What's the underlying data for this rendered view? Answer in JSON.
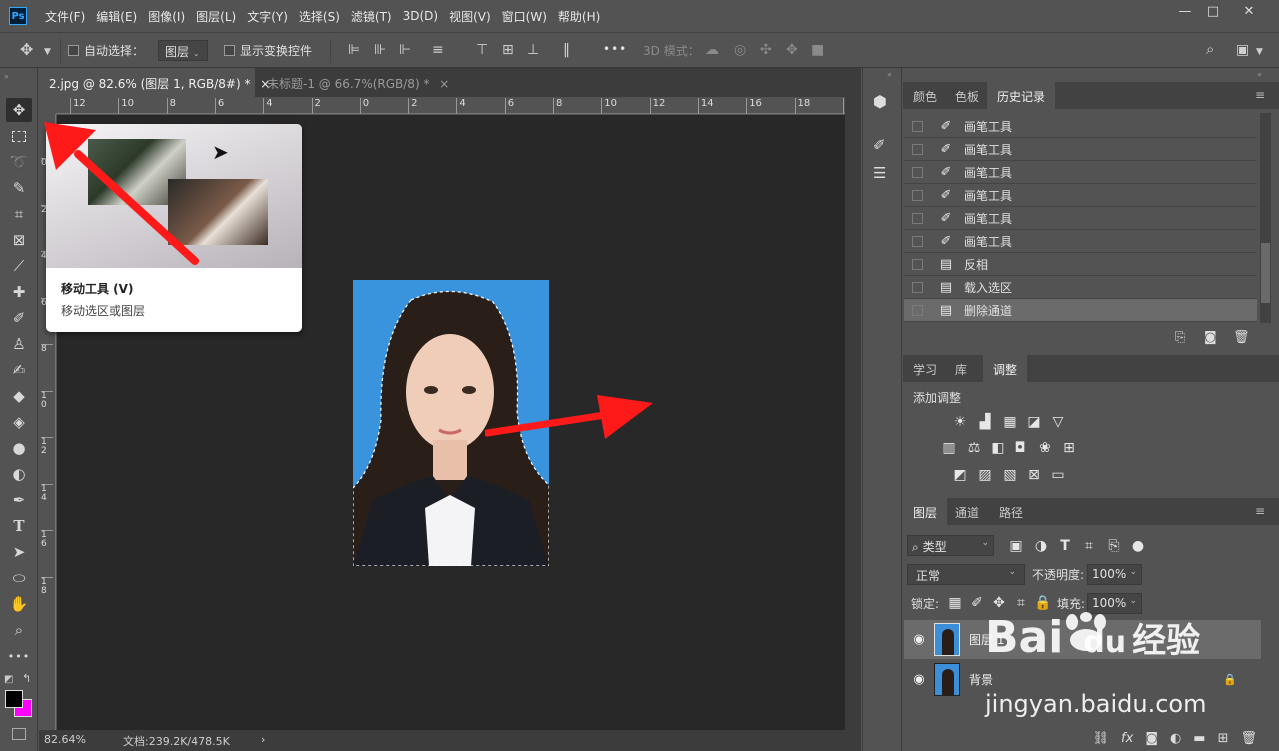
{
  "menu": {
    "logo": "Ps",
    "items": [
      "文件(F)",
      "编辑(E)",
      "图像(I)",
      "图层(L)",
      "文字(Y)",
      "选择(S)",
      "滤镜(T)",
      "3D(D)",
      "视图(V)",
      "窗口(W)",
      "帮助(H)"
    ],
    "minimize": "—",
    "restore": "□",
    "close": "✕"
  },
  "options": {
    "auto_select_label": "自动选择：",
    "auto_select_value": "图层",
    "show_transform_label": "显示变换控件",
    "more": "•••",
    "mode3d_label": "3D 模式："
  },
  "tabs": [
    {
      "label": "2.jpg @ 82.6% (图层 1, RGB/8#) *",
      "close": "×"
    },
    {
      "label": "未标题-1 @ 66.7%(RGB/8) *",
      "close": "×"
    }
  ],
  "ruler": {
    "h_ticks": [
      "12",
      "10",
      "8",
      "6",
      "4",
      "2",
      "0",
      "2",
      "4",
      "6",
      "8",
      "10",
      "12",
      "14",
      "16",
      "18",
      "20"
    ],
    "v_ticks": [
      "0",
      "2",
      "4",
      "6",
      "8",
      "1\n0",
      "1\n2",
      "1\n4",
      "1\n6",
      "1\n8"
    ]
  },
  "tooltip": {
    "title": "移动工具 (V)",
    "description": "移动选区或图层"
  },
  "status": {
    "zoom": "82.64%",
    "doc": "文档:239.2K/478.5K",
    "arrow": "›"
  },
  "history_panel": {
    "tabs": [
      "颜色",
      "色板",
      "历史记录"
    ],
    "active_tab": 2,
    "rows": [
      {
        "icon": "brush-icon",
        "label": "画笔工具"
      },
      {
        "icon": "brush-icon",
        "label": "画笔工具"
      },
      {
        "icon": "brush-icon",
        "label": "画笔工具"
      },
      {
        "icon": "brush-icon",
        "label": "画笔工具"
      },
      {
        "icon": "brush-icon",
        "label": "画笔工具"
      },
      {
        "icon": "brush-icon",
        "label": "画笔工具"
      },
      {
        "icon": "document-icon",
        "label": "反相"
      },
      {
        "icon": "document-icon",
        "label": "载入选区"
      },
      {
        "icon": "document-icon",
        "label": "删除通道"
      }
    ],
    "selected_row": 8
  },
  "adjust_panel": {
    "tabs": [
      "学习",
      "库",
      "调整"
    ],
    "active_tab": 2,
    "title": "添加调整"
  },
  "layers_panel": {
    "tabs": [
      "图层",
      "通道",
      "路径"
    ],
    "active_tab": 0,
    "filter_label": "类型",
    "blend_mode": "正常",
    "opacity_label": "不透明度:",
    "opacity_value": "100%",
    "lock_label": "锁定:",
    "fill_label": "填充:",
    "fill_value": "100%",
    "layers": [
      {
        "name": "图层 1",
        "visible": true,
        "selected": true,
        "locked": false
      },
      {
        "name": "背景",
        "visible": true,
        "selected": false,
        "locked": true
      }
    ]
  },
  "watermark": {
    "brand": "Bai",
    "du": "du",
    "jingyan": "经验",
    "url": "jingyan.baidu.com"
  },
  "colors": {
    "foreground": "#000000",
    "background": "#ff00ff",
    "photo_bg": "#3a93dd",
    "arrow": "#ff1a1a"
  }
}
